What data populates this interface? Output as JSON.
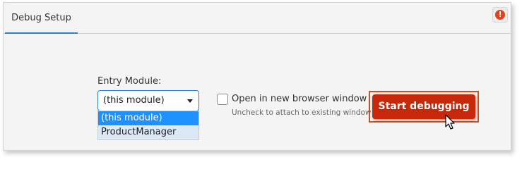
{
  "tabs": [
    {
      "label": "Debug Setup",
      "active": true
    }
  ],
  "status": {
    "error_icon": "exclamation-circle-icon",
    "error_glyph": "!",
    "error_color": "#e0421e"
  },
  "entry_module": {
    "label": "Entry Module:",
    "selected_value": "(this module)",
    "options": [
      "(this module)",
      "ProductManager"
    ]
  },
  "open_new_window": {
    "label": "Open in new browser window",
    "hint": "Uncheck to attach to existing window",
    "checked": false
  },
  "start_button": {
    "label": "Start debugging",
    "color": "#c8280a",
    "highlight_color": "#d94a1c"
  },
  "colors": {
    "accent": "#2a7fd4",
    "selected_option": "#1e90ff",
    "hover_option": "#dbe8f6"
  }
}
